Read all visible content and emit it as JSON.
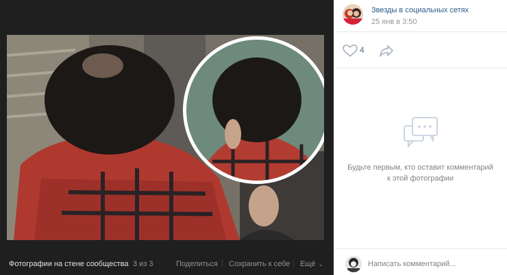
{
  "viewer": {
    "album_title": "Фотографии на стене сообщества",
    "counter": "3 из 3",
    "share_label": "Поделиться",
    "save_label": "Сохранить к себе",
    "more_label": "Ещё"
  },
  "post": {
    "group_name": "Звезды в социальных сетях",
    "date": "25 янв в 3:50",
    "like_count": "4"
  },
  "comments": {
    "empty_text": "Будьте первым, кто оставит комментарий к этой фотографии",
    "input_placeholder": "Написать комментарий..."
  },
  "icons": {
    "like": "heart-icon",
    "share": "share-arrow-icon",
    "empty": "speech-bubbles-icon",
    "more": "chevron-down-icon"
  },
  "colors": {
    "viewer_bg": "#1f1f1f",
    "link": "#2a5885",
    "muted": "#939699",
    "icon": "#aeb7c2"
  }
}
